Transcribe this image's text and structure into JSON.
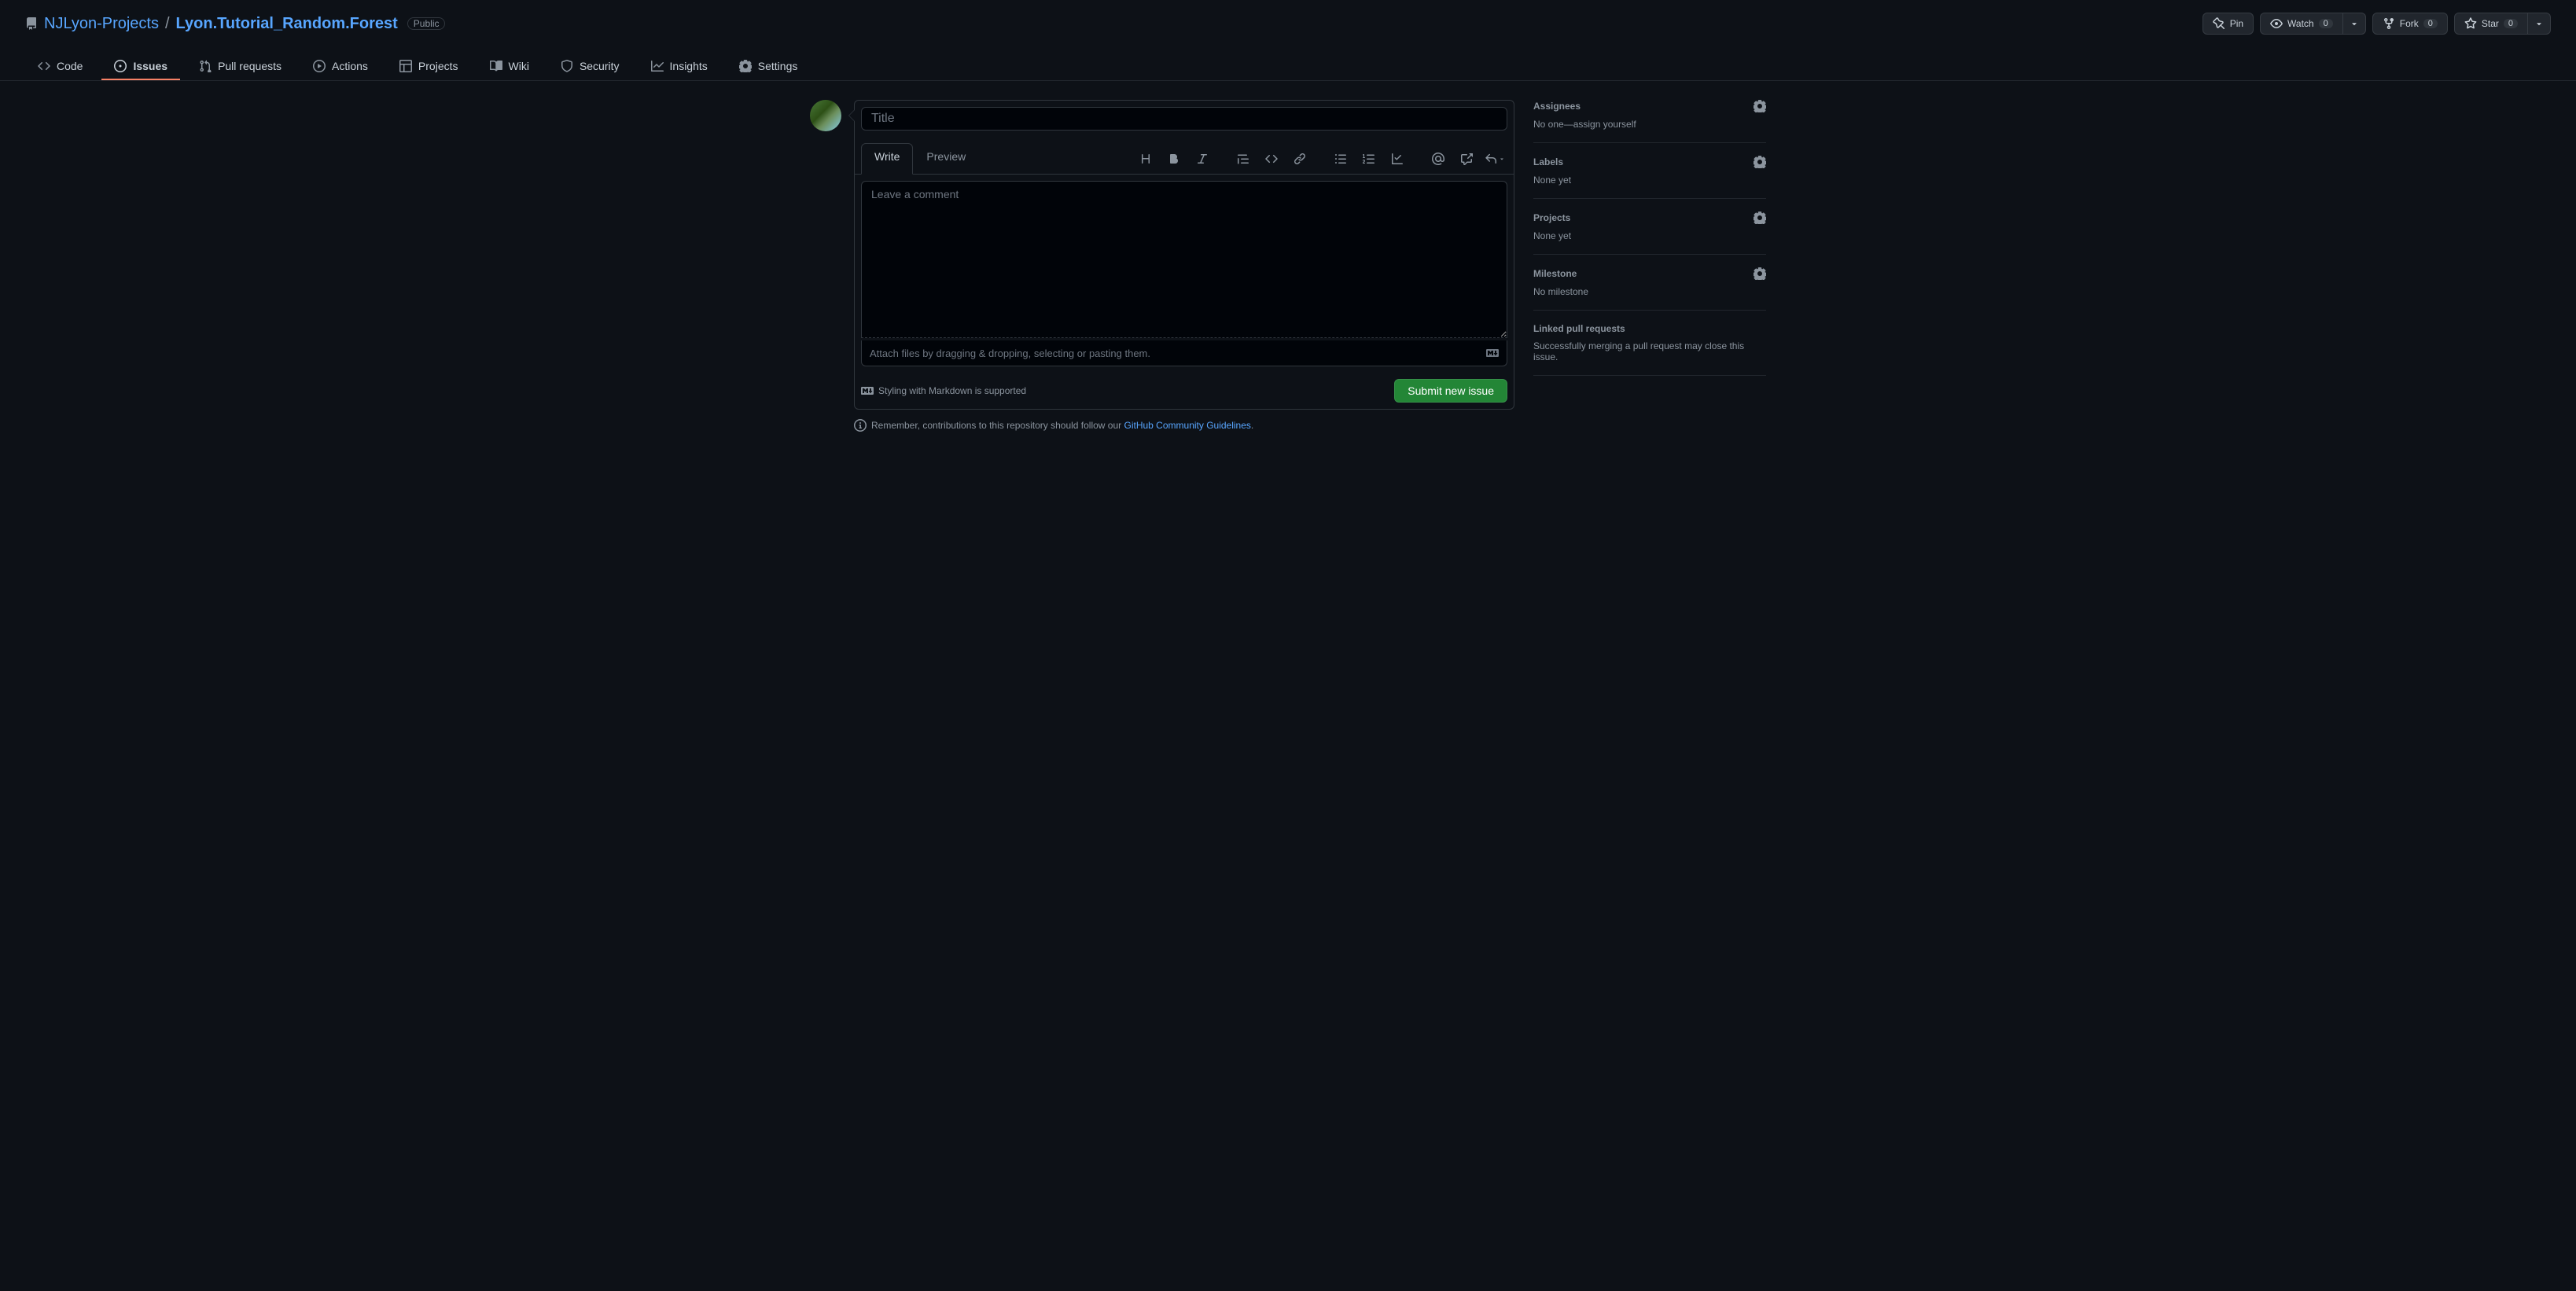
{
  "repo": {
    "owner": "NJLyon-Projects",
    "name": "Lyon.Tutorial_Random.Forest",
    "visibility": "Public"
  },
  "header_actions": {
    "pin": "Pin",
    "watch": "Watch",
    "watch_count": "0",
    "fork": "Fork",
    "fork_count": "0",
    "star": "Star",
    "star_count": "0"
  },
  "nav": {
    "code": "Code",
    "issues": "Issues",
    "pull_requests": "Pull requests",
    "actions": "Actions",
    "projects": "Projects",
    "wiki": "Wiki",
    "security": "Security",
    "insights": "Insights",
    "settings": "Settings"
  },
  "form": {
    "title_placeholder": "Title",
    "write_tab": "Write",
    "preview_tab": "Preview",
    "comment_placeholder": "Leave a comment",
    "attach_hint": "Attach files by dragging & dropping, selecting or pasting them.",
    "md_support": "Styling with Markdown is supported",
    "submit": "Submit new issue"
  },
  "notice": {
    "prefix": "Remember, contributions to this repository should follow our ",
    "link": "GitHub Community Guidelines",
    "suffix": "."
  },
  "sidebar": {
    "assignees": {
      "title": "Assignees",
      "value": "No one—assign yourself"
    },
    "labels": {
      "title": "Labels",
      "value": "None yet"
    },
    "projects": {
      "title": "Projects",
      "value": "None yet"
    },
    "milestone": {
      "title": "Milestone",
      "value": "No milestone"
    },
    "linked_prs": {
      "title": "Linked pull requests",
      "value": "Successfully merging a pull request may close this issue."
    }
  }
}
